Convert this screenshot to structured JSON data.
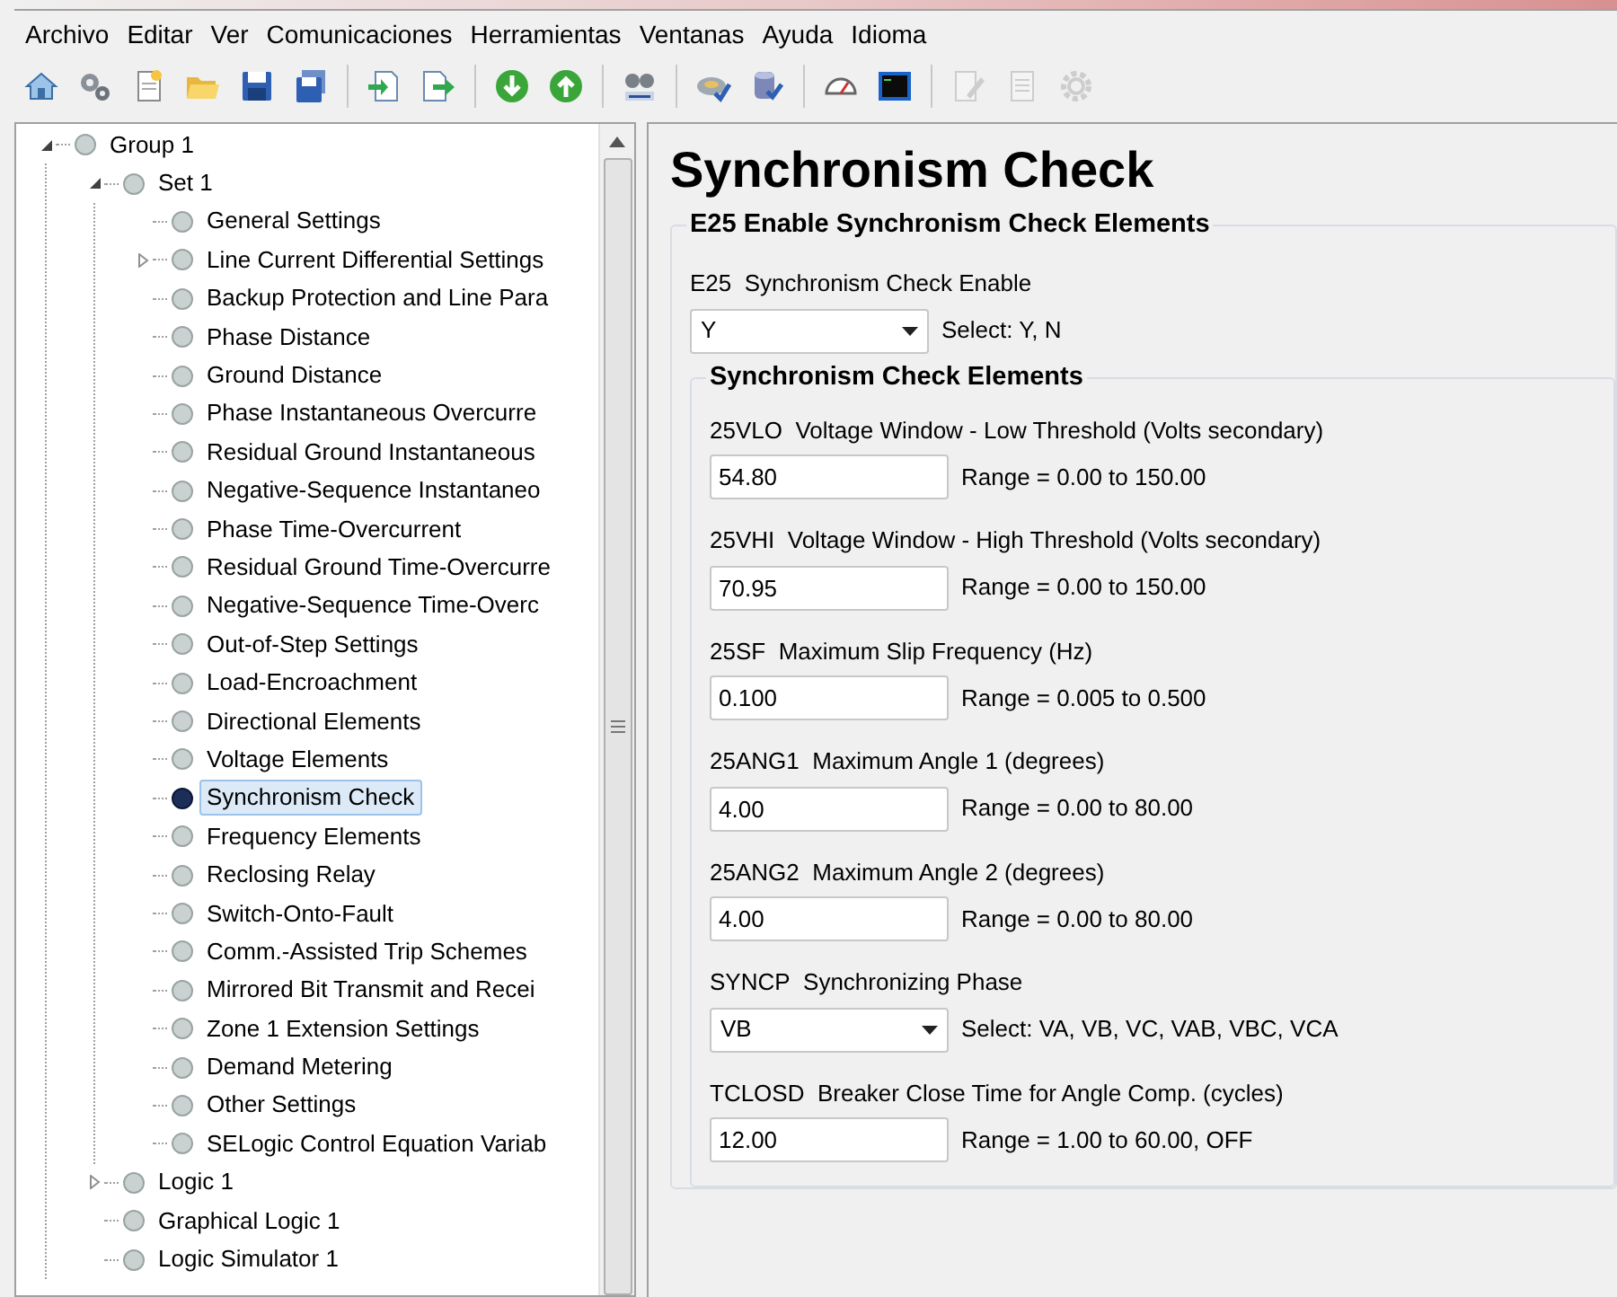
{
  "menu": [
    "Archivo",
    "Editar",
    "Ver",
    "Comunicaciones",
    "Herramientas",
    "Ventanas",
    "Ayuda",
    "Idioma"
  ],
  "toolbar": [
    {
      "kind": "home",
      "disabled": false
    },
    {
      "kind": "gears",
      "disabled": false
    },
    {
      "kind": "new",
      "disabled": false
    },
    {
      "kind": "open",
      "disabled": false
    },
    {
      "kind": "save",
      "disabled": false
    },
    {
      "kind": "save-all",
      "disabled": false
    },
    {
      "kind": "separator"
    },
    {
      "kind": "import",
      "disabled": false
    },
    {
      "kind": "export",
      "disabled": false
    },
    {
      "kind": "separator"
    },
    {
      "kind": "down",
      "disabled": false
    },
    {
      "kind": "up",
      "disabled": false
    },
    {
      "kind": "separator"
    },
    {
      "kind": "spell",
      "disabled": false
    },
    {
      "kind": "separator"
    },
    {
      "kind": "connect",
      "disabled": false
    },
    {
      "kind": "database",
      "disabled": false
    },
    {
      "kind": "separator"
    },
    {
      "kind": "gauge",
      "disabled": false
    },
    {
      "kind": "terminal",
      "disabled": false
    },
    {
      "kind": "separator"
    },
    {
      "kind": "edit",
      "disabled": true
    },
    {
      "kind": "document",
      "disabled": true
    },
    {
      "kind": "gear",
      "disabled": true
    }
  ],
  "tree": [
    {
      "label": "Group 1",
      "expanded": true,
      "selected": false,
      "children": [
        {
          "label": "Set 1",
          "expanded": true,
          "selected": false,
          "children": [
            {
              "label": "General Settings",
              "selected": false
            },
            {
              "label": "Line Current Differential Settings",
              "selected": false,
              "expanded": false
            },
            {
              "label": "Backup Protection and Line Para",
              "selected": false
            },
            {
              "label": "Phase Distance",
              "selected": false
            },
            {
              "label": "Ground Distance",
              "selected": false
            },
            {
              "label": "Phase Instantaneous Overcurre",
              "selected": false
            },
            {
              "label": "Residual Ground Instantaneous",
              "selected": false
            },
            {
              "label": "Negative-Sequence Instantaneo",
              "selected": false
            },
            {
              "label": "Phase Time-Overcurrent",
              "selected": false
            },
            {
              "label": "Residual Ground Time-Overcurre",
              "selected": false
            },
            {
              "label": "Negative-Sequence Time-Overc",
              "selected": false
            },
            {
              "label": "Out-of-Step Settings",
              "selected": false
            },
            {
              "label": "Load-Encroachment",
              "selected": false
            },
            {
              "label": "Directional Elements",
              "selected": false
            },
            {
              "label": "Voltage Elements",
              "selected": false
            },
            {
              "label": "Synchronism Check",
              "selected": true
            },
            {
              "label": "Frequency Elements",
              "selected": false
            },
            {
              "label": "Reclosing Relay",
              "selected": false
            },
            {
              "label": "Switch-Onto-Fault",
              "selected": false
            },
            {
              "label": "Comm.-Assisted Trip Schemes",
              "selected": false
            },
            {
              "label": "Mirrored Bit Transmit and Recei",
              "selected": false
            },
            {
              "label": "Zone 1 Extension Settings",
              "selected": false
            },
            {
              "label": "Demand Metering",
              "selected": false
            },
            {
              "label": "Other Settings",
              "selected": false
            },
            {
              "label": "SELogic Control Equation Variab",
              "selected": false
            }
          ]
        },
        {
          "label": "Logic 1",
          "selected": false,
          "expanded": false
        },
        {
          "label": "Graphical Logic 1",
          "selected": false
        },
        {
          "label": "Logic Simulator 1",
          "selected": false
        }
      ]
    }
  ],
  "page": {
    "title": "Synchronism Check",
    "group": {
      "title": "E25 Enable Synchronism Check Elements",
      "fields": [
        {
          "kind": "select",
          "code": "E25",
          "label": "Synchronism Check Enable",
          "value": "Y",
          "hint": "Select: Y, N"
        }
      ],
      "subgroup": {
        "title": "Synchronism Check Elements",
        "fields": [
          {
            "kind": "text",
            "code": "25VLO",
            "label": "Voltage Window - Low Threshold (Volts secondary)",
            "value": "54.80",
            "hint": "Range = 0.00 to 150.00"
          },
          {
            "kind": "text",
            "code": "25VHI",
            "label": "Voltage Window - High Threshold (Volts secondary)",
            "value": "70.95",
            "hint": "Range = 0.00 to 150.00"
          },
          {
            "kind": "text",
            "code": "25SF",
            "label": "Maximum Slip Frequency (Hz)",
            "value": "0.100",
            "hint": "Range = 0.005 to 0.500"
          },
          {
            "kind": "text",
            "code": "25ANG1",
            "label": "Maximum Angle 1 (degrees)",
            "value": "4.00",
            "hint": "Range = 0.00 to 80.00"
          },
          {
            "kind": "text",
            "code": "25ANG2",
            "label": "Maximum Angle 2 (degrees)",
            "value": "4.00",
            "hint": "Range = 0.00 to 80.00"
          },
          {
            "kind": "select",
            "code": "SYNCP",
            "label": "Synchronizing Phase",
            "value": "VB",
            "hint": "Select: VA, VB, VC, VAB, VBC, VCA"
          },
          {
            "kind": "text",
            "code": "TCLOSD",
            "label": "Breaker Close Time for Angle Comp. (cycles)",
            "value": "12.00",
            "hint": "Range = 1.00 to 60.00, OFF"
          }
        ]
      }
    }
  }
}
